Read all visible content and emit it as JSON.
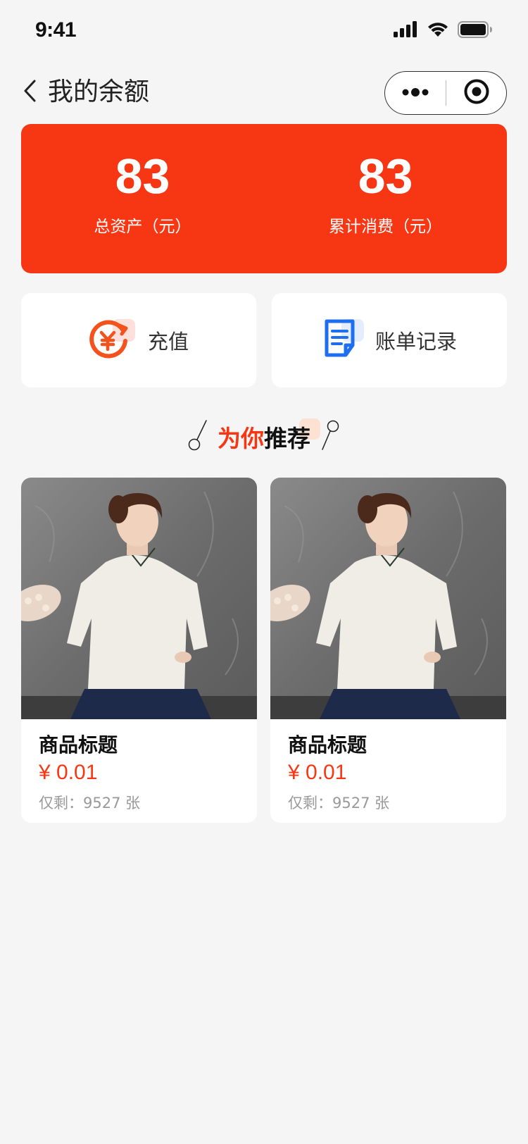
{
  "status_bar": {
    "time": "9:41",
    "icons": [
      "signal-icon",
      "wifi-icon",
      "battery-icon"
    ]
  },
  "nav": {
    "title": "我的余额",
    "back_icon": "chevron-left-icon",
    "more_icon": "more-dots-icon",
    "close_icon": "target-circle-icon"
  },
  "balance": {
    "total_assets": {
      "value": "83",
      "label": "总资产（元）"
    },
    "total_spent": {
      "value": "83",
      "label": "累计消费（元）"
    },
    "color": "#f73614"
  },
  "actions": [
    {
      "label": "充值",
      "icon": "recharge-yen-icon"
    },
    {
      "label": "账单记录",
      "icon": "bill-document-icon"
    }
  ],
  "recommend": {
    "title_red": "为你",
    "title_dark": "推荐"
  },
  "products": [
    {
      "title": "商品标题",
      "price": "¥ 0.01",
      "stock": "仅剩：9527 张",
      "image": "model-in-white-qipao-top"
    },
    {
      "title": "商品标题",
      "price": "¥ 0.01",
      "stock": "仅剩：9527 张",
      "image": "model-in-white-qipao-top"
    }
  ]
}
